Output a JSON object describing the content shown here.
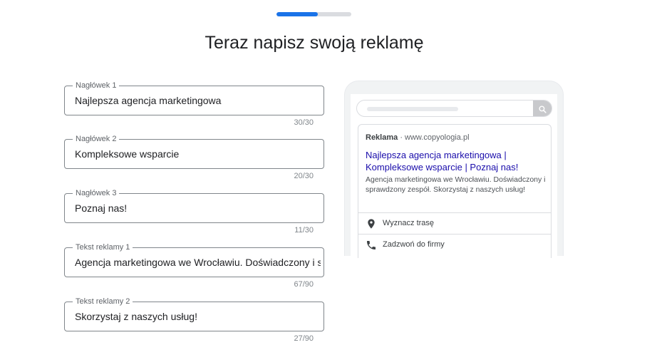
{
  "progress": {
    "fraction": 0.55,
    "fill_color": "#1a73e8",
    "track_color": "#dadce0"
  },
  "page": {
    "title": "Teraz napisz swoją reklamę"
  },
  "fields": [
    {
      "label": "Nagłówek 1",
      "value": "Najlepsza agencja marketingowa",
      "counter": "30/30"
    },
    {
      "label": "Nagłówek 2",
      "value": "Kompleksowe wsparcie",
      "counter": "20/30"
    },
    {
      "label": "Nagłówek 3",
      "value": "Poznaj nas!",
      "counter": "11/30"
    },
    {
      "label": "Tekst reklamy 1",
      "value": "Agencja marketingowa we Wrocławiu. Doświadczony i sprawdzony zespół. Skorzystaj z",
      "counter": "67/90"
    },
    {
      "label": "Tekst reklamy 2",
      "value": "Skorzystaj z naszych usług!",
      "counter": "27/90"
    }
  ],
  "preview": {
    "search_icon": "search-icon",
    "ad_label": "Reklama",
    "ad_url": "· www.copyologia.pl",
    "headline": "Najlepsza agencja marketingowa | Kompleksowe wsparcie | Poznaj nas!",
    "description": "Agencja marketingowa we Wrocławiu. Doświadczony i sprawdzony zespół. Skorzystaj z naszych usług!",
    "extensions": [
      {
        "icon": "location-pin-icon",
        "label": "Wyznacz trasę"
      },
      {
        "icon": "phone-icon",
        "label": "Zadzwoń do firmy"
      }
    ],
    "headline_color": "#1a0dab"
  }
}
